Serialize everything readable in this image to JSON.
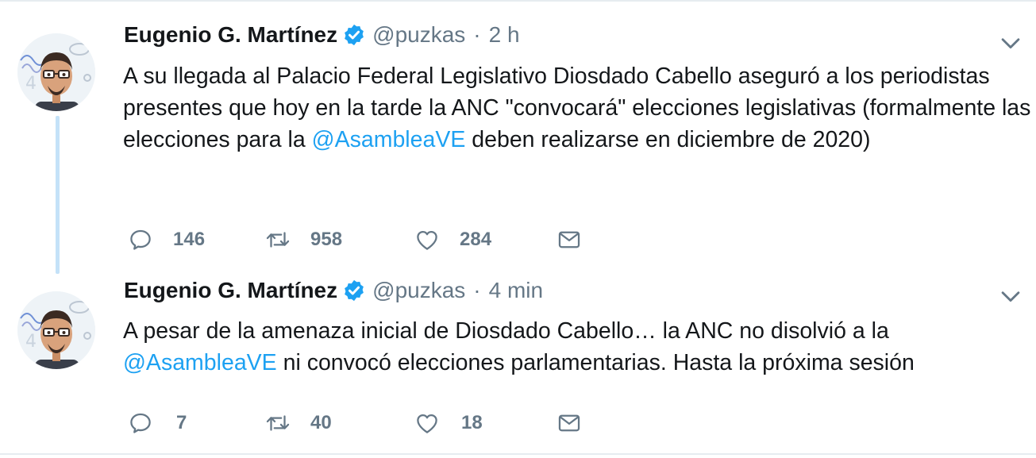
{
  "theme": {
    "accent": "#1da1f2",
    "muted": "#657786",
    "text": "#14171a",
    "thread_line": "#c4e2f8"
  },
  "tweets": [
    {
      "author": {
        "name": "Eugenio G. Martínez",
        "handle": "@puzkas",
        "verified": true,
        "avatar_icon": "cartoon-avatar"
      },
      "separator": "·",
      "time": "2 h",
      "text_parts": {
        "before": "A su llegada al Palacio Federal Legislativo Diosdado Cabello aseguró a los periodistas presentes que hoy en la tarde la ANC \"convocará\" elecciones legislativas (formalmente las elecciones para la ",
        "mention": "@AsambleaVE",
        "after": " deben realizarse en diciembre de 2020)"
      },
      "actions": {
        "replies": "146",
        "retweets": "958",
        "likes": "284"
      },
      "icons": [
        "reply-icon",
        "retweet-icon",
        "like-icon",
        "direct-message-icon",
        "caret-down-icon",
        "verified-badge-icon"
      ]
    },
    {
      "author": {
        "name": "Eugenio G. Martínez",
        "handle": "@puzkas",
        "verified": true,
        "avatar_icon": "cartoon-avatar"
      },
      "separator": "·",
      "time": "4 min",
      "text_parts": {
        "before": "A pesar de la amenaza inicial de Diosdado Cabello… la ANC no disolvió a la ",
        "mention": "@AsambleaVE",
        "after": " ni convocó elecciones parlamentarias. Hasta la próxima sesión"
      },
      "actions": {
        "replies": "7",
        "retweets": "40",
        "likes": "18"
      },
      "icons": [
        "reply-icon",
        "retweet-icon",
        "like-icon",
        "direct-message-icon",
        "caret-down-icon",
        "verified-badge-icon"
      ]
    }
  ]
}
